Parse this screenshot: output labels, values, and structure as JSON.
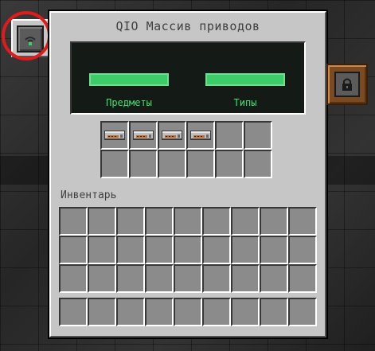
{
  "window": {
    "title": "QIO Массив приводов"
  },
  "screen": {
    "items_label": "Предметы",
    "types_label": "Типы",
    "items_fill": 1.0,
    "types_fill": 1.0,
    "bar_color": "#3ecc6a",
    "text_color": "#3fe06e"
  },
  "drive_slots": {
    "rows": 2,
    "cols": 6,
    "items": [
      {
        "slot": 0,
        "icon": "qio-drive-icon"
      },
      {
        "slot": 1,
        "icon": "qio-drive-icon"
      },
      {
        "slot": 2,
        "icon": "qio-drive-icon"
      },
      {
        "slot": 3,
        "icon": "qio-drive-icon"
      }
    ]
  },
  "inventory": {
    "label": "Инвентарь",
    "rows": 3,
    "cols": 9,
    "hotbar_cols": 9
  },
  "side_tabs": {
    "left_icon": "signal-icon",
    "right_icon": "lock-icon"
  },
  "highlight_color": "#e01b1b"
}
